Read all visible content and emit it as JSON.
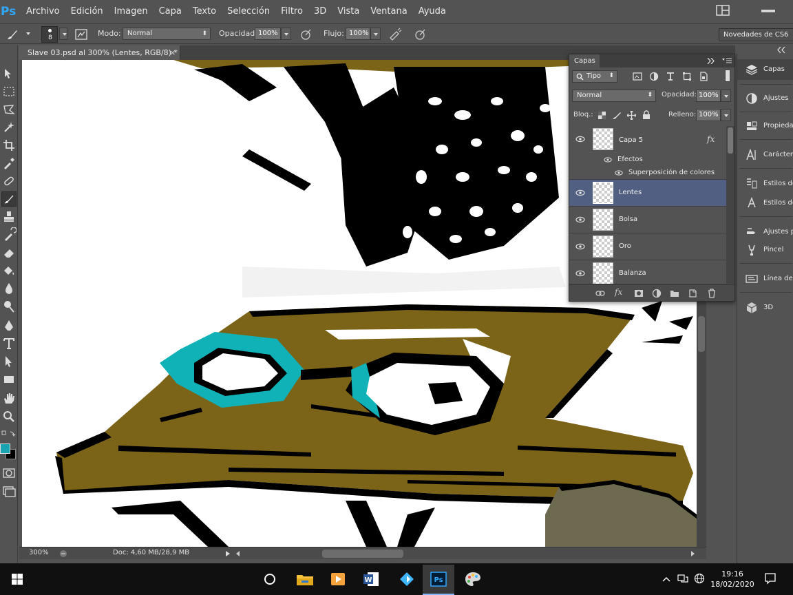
{
  "app": {
    "logo": "Ps"
  },
  "menu": [
    "Archivo",
    "Edición",
    "Imagen",
    "Capa",
    "Texto",
    "Selección",
    "Filtro",
    "3D",
    "Vista",
    "Ventana",
    "Ayuda"
  ],
  "options": {
    "brush_size": "8",
    "mode_label": "Modo:",
    "mode_value": "Normal",
    "opacity_label": "Opacidad:",
    "opacity_value": "100%",
    "flow_label": "Flujo:",
    "flow_value": "100%",
    "workspace": "Novedades de CS6"
  },
  "document": {
    "tab_title": "Slave 03.psd al 300% (Lentes, RGB/8) *",
    "close_glyph": "×",
    "zoom": "300%",
    "doc_info": "Doc: 4,60 MB/28,9 MB"
  },
  "layers_panel": {
    "tab": "Capas",
    "filter_kind": "Tipo",
    "blend_mode": "Normal",
    "opacity_label": "Opacidad:",
    "opacity_value": "100%",
    "lock_label": "Bloq.:",
    "fill_label": "Relleno:",
    "fill_value": "100%",
    "fx_glyph": "fx",
    "effects_label": "Efectos",
    "effect_name": "Superposición de colores",
    "layers": [
      {
        "name": "Capa 5",
        "has_fx": true,
        "selected": false
      },
      {
        "name": "Lentes",
        "selected": true
      },
      {
        "name": "Bolsa",
        "selected": false
      },
      {
        "name": "Oro",
        "selected": false
      },
      {
        "name": "Balanza",
        "selected": false
      }
    ]
  },
  "dock": [
    "Capas",
    "Ajustes",
    "Propiedades",
    "Carácter",
    "Estilos de párrafo",
    "Estilos de carácter",
    "Ajustes preestablecidos de herramienta",
    "Pincel",
    "Línea de tiempo",
    "3D"
  ],
  "colors": {
    "foreground": "#1aa3b0",
    "background": "#000000",
    "olive": "#7b6417",
    "teal": "#10b2b8"
  },
  "taskbar": {
    "time": "19:16",
    "date": "18/02/2020"
  }
}
